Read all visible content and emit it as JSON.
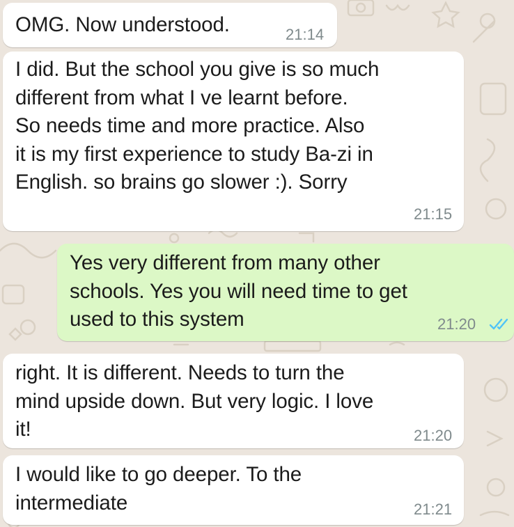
{
  "chat": {
    "messages": [
      {
        "direction": "incoming",
        "text": "OMG. Now understood.",
        "time": "21:14"
      },
      {
        "direction": "incoming",
        "text": "I did. But the school you give is so much\ndifferent from what I ve learnt before.\nSo needs time and more practice. Also\nit is my first experience to study Ba-zi in\nEnglish. so brains go slower :). Sorry",
        "time": "21:15"
      },
      {
        "direction": "outgoing",
        "text": "Yes very different from many other\nschools. Yes you will need time to get\nused to this system",
        "time": "21:20",
        "status": "read"
      },
      {
        "direction": "incoming",
        "text": "right. It is different. Needs to turn the\nmind upside down. But very logic. I love\nit!",
        "time": "21:20"
      },
      {
        "direction": "incoming",
        "text": "I would like to go deeper. To the\nintermediate",
        "time": "21:21"
      }
    ]
  },
  "icons": {
    "read_receipt": "double-check-icon"
  },
  "colors": {
    "background": "#ece5dd",
    "incoming_bubble": "#ffffff",
    "outgoing_bubble": "#dcf8c6",
    "timestamp": "#7f8a8c",
    "read_ticks": "#4fc3f7"
  }
}
